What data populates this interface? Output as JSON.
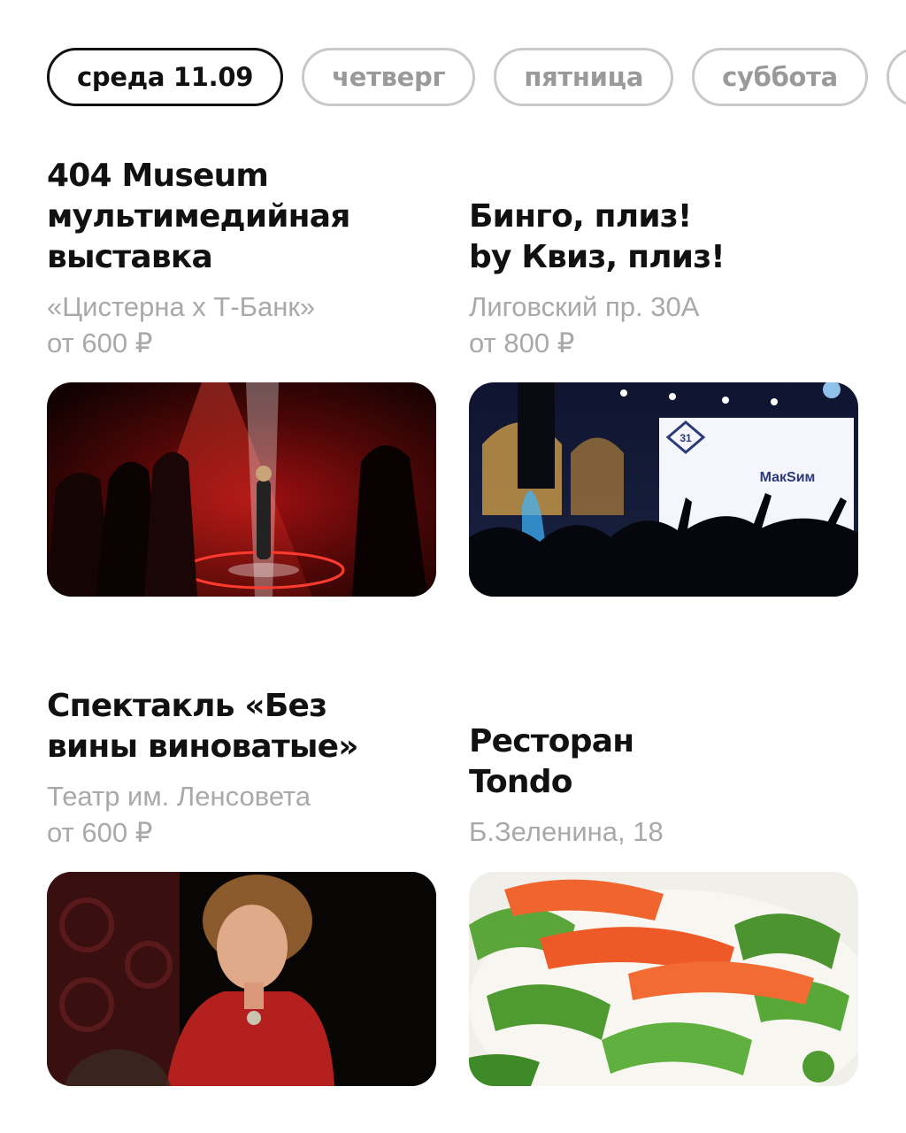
{
  "tabs": [
    {
      "label": "среда 11.09",
      "active": true
    },
    {
      "label": "четверг",
      "active": false
    },
    {
      "label": "пятница",
      "active": false
    },
    {
      "label": "суббота",
      "active": false
    },
    {
      "label": "",
      "active": false
    }
  ],
  "events": [
    {
      "title_lines": [
        "404 Museum",
        "мультимедийная",
        "выставка"
      ],
      "venue": "«Цистерна х Т-Банк»",
      "price": "от 600 ₽",
      "image": "exhibition-red-laser-photo"
    },
    {
      "title_lines": [
        "Бинго, плиз!",
        "by Квиз, плиз!"
      ],
      "venue": "Лиговский пр. 30А",
      "price": "от 800 ₽",
      "image": "concert-crowd-stage-photo",
      "screen_text": "МакSим",
      "screen_badge": "31"
    },
    {
      "title_lines": [
        "Спектакль «Без",
        "вины виноватые»"
      ],
      "venue": "Театр им. Ленсовета",
      "price": "от 600 ₽",
      "image": "actress-red-dress-photo"
    },
    {
      "title_lines": [
        "Ресторан",
        "Tondo"
      ],
      "venue": "Б.Зеленина, 18",
      "price": "",
      "image": "salmon-pasta-dish-photo"
    }
  ],
  "colors": {
    "active_tab": "#111111",
    "inactive_tab": "#c9c9c9",
    "muted_text": "#a9a9a9"
  }
}
